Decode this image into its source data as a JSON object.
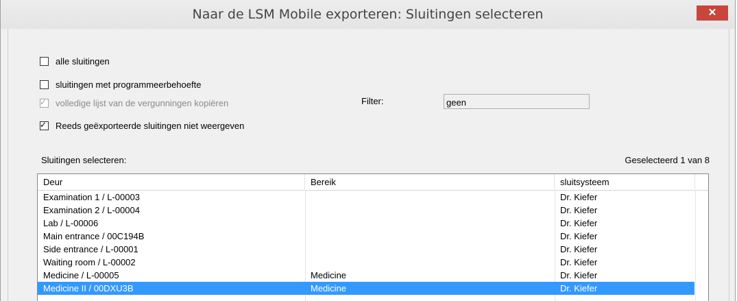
{
  "window": {
    "title": "Naar de LSM Mobile exporteren: Sluitingen selecteren",
    "close_glyph": "✕"
  },
  "options": {
    "all": {
      "label": "alle sluitingen",
      "checked": false
    },
    "programming": {
      "label": "sluitingen met programmeerbehoefte",
      "checked": false
    },
    "full_list": {
      "label": "volledige lijst van de vergunningen kopiëren",
      "checked": true,
      "disabled": true
    },
    "hide_exported": {
      "label": "Reeds geëxporteerde sluitingen niet weergeven",
      "checked": true
    }
  },
  "filter": {
    "label": "Filter:",
    "value": "geen"
  },
  "selection": {
    "label": "Sluitingen selecteren:",
    "count_text": "Geselecteerd 1 van 8"
  },
  "table": {
    "columns": [
      "Deur",
      "Bereik",
      "sluitsysteem"
    ],
    "rows": [
      {
        "door": "Examination 1 / L-00003",
        "area": "",
        "system": "Dr. Kiefer"
      },
      {
        "door": "Examination 2 / L-00004",
        "area": "",
        "system": "Dr. Kiefer"
      },
      {
        "door": "Lab / L-00006",
        "area": "",
        "system": "Dr. Kiefer"
      },
      {
        "door": "Main entrance / 00C194B",
        "area": "",
        "system": "Dr. Kiefer"
      },
      {
        "door": "Side entrance / L-00001",
        "area": "",
        "system": "Dr. Kiefer"
      },
      {
        "door": "Waiting room / L-00002",
        "area": "",
        "system": "Dr. Kiefer"
      },
      {
        "door": "Medicine / L-00005",
        "area": "Medicine",
        "system": "Dr. Kiefer"
      },
      {
        "door": "Medicine II / 00DXU3B",
        "area": "Medicine",
        "system": "Dr. Kiefer",
        "selected": true
      }
    ]
  },
  "colors": {
    "selection": "#3399ff",
    "close_button": "#c9463d"
  }
}
